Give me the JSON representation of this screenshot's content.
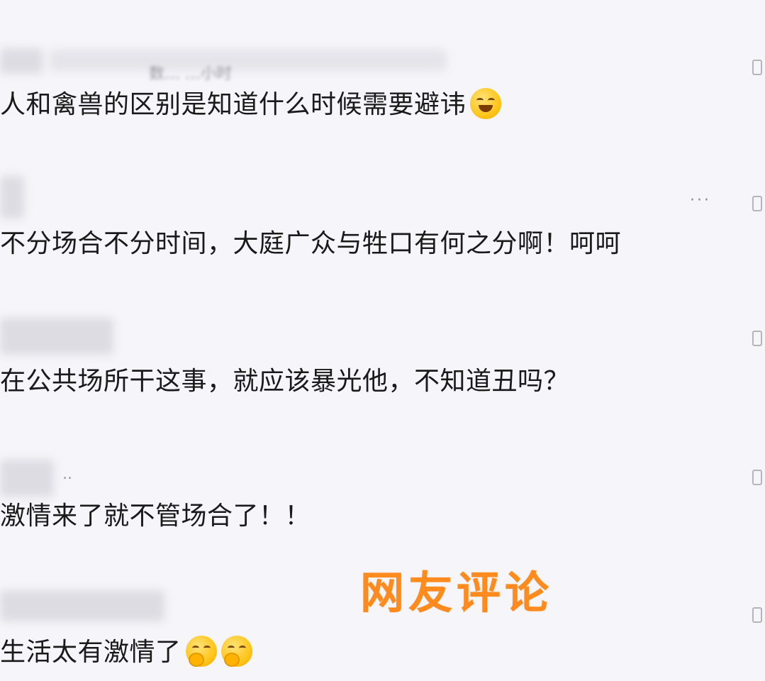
{
  "comments": [
    {
      "meta": "数…          …小时",
      "text": "人和禽兽的区别是知道什么时候需要避讳",
      "emoji": "grinning-sweat-emoji"
    },
    {
      "meta": "",
      "text": "不分场合不分时间，大庭广众与牲口有何之分啊！呵呵",
      "more": "···"
    },
    {
      "meta": "",
      "text": "在公共场所干这事，就应该暴光他，不知道丑吗？"
    },
    {
      "meta": "..",
      "text": "激情来了就不管场合了！！"
    },
    {
      "meta": "",
      "text": "生活太有激情了",
      "emoji": "face-with-hand-over-mouth-emoji"
    }
  ],
  "watermark": "网友评论"
}
